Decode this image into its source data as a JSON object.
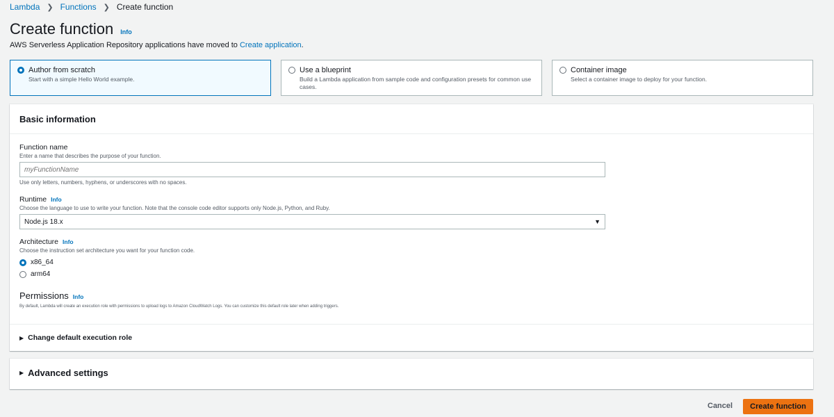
{
  "breadcrumb": [
    "Lambda",
    "Functions",
    "Create function"
  ],
  "page": {
    "title": "Create function",
    "info": "Info",
    "subtitle_prefix": "AWS Serverless Application Repository applications have moved to ",
    "subtitle_link": "Create application",
    "subtitle_suffix": "."
  },
  "options": [
    {
      "title": "Author from scratch",
      "desc": "Start with a simple Hello World example.",
      "selected": true
    },
    {
      "title": "Use a blueprint",
      "desc": "Build a Lambda application from sample code and configuration presets for common use cases.",
      "selected": false
    },
    {
      "title": "Container image",
      "desc": "Select a container image to deploy for your function.",
      "selected": false
    }
  ],
  "basic": {
    "header": "Basic information",
    "function_name": {
      "label": "Function name",
      "desc": "Enter a name that describes the purpose of your function.",
      "placeholder": "myFunctionName",
      "hint": "Use only letters, numbers, hyphens, or underscores with no spaces."
    },
    "runtime": {
      "label": "Runtime",
      "info": "Info",
      "desc": "Choose the language to use to write your function. Note that the console code editor supports only Node.js, Python, and Ruby.",
      "value": "Node.js 18.x"
    },
    "architecture": {
      "label": "Architecture",
      "info": "Info",
      "desc": "Choose the instruction set architecture you want for your function code.",
      "options": [
        "x86_64",
        "arm64"
      ],
      "selected": "x86_64"
    },
    "permissions": {
      "title": "Permissions",
      "info": "Info",
      "desc": "By default, Lambda will create an execution role with permissions to upload logs to Amazon CloudWatch Logs. You can customize this default role later when adding triggers."
    },
    "change_role": "Change default execution role"
  },
  "advanced": "Advanced settings",
  "footer": {
    "cancel": "Cancel",
    "create": "Create function"
  },
  "colors": {
    "link": "#0073bb",
    "primary_button": "#ec7211",
    "background": "#f2f3f3"
  }
}
